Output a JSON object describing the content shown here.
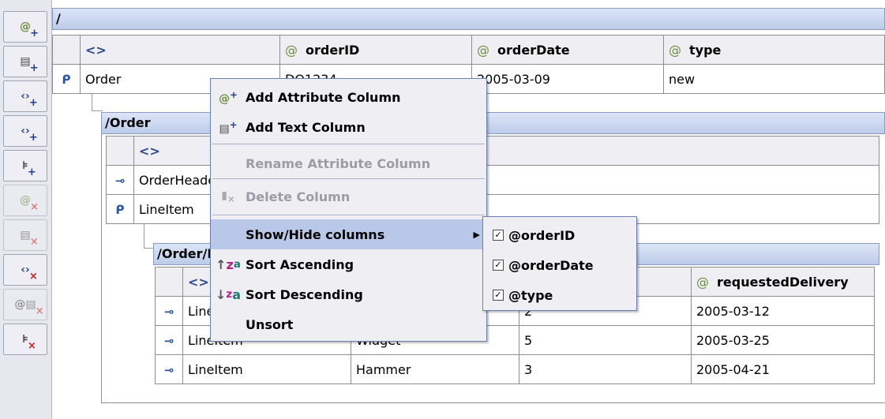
{
  "toolbar": {
    "buttons": [
      {
        "icon": "add-attribute-icon",
        "glyph": "@",
        "badge": "+",
        "enabled": true
      },
      {
        "icon": "add-text-icon",
        "glyph": "▤",
        "badge": "+",
        "enabled": true
      },
      {
        "icon": "add-element-icon",
        "glyph": "‹›",
        "badge": "+",
        "enabled": true
      },
      {
        "icon": "add-child-element-icon",
        "glyph": "‹›",
        "badge": "+",
        "enabled": true
      },
      {
        "icon": "add-tree-icon",
        "glyph": "⊧",
        "badge": "+",
        "enabled": true
      },
      {
        "icon": "delete-attribute-icon",
        "glyph": "@",
        "badge": "×",
        "enabled": false
      },
      {
        "icon": "delete-text-icon",
        "glyph": "▤",
        "badge": "×",
        "enabled": false
      },
      {
        "icon": "delete-element-icon",
        "glyph": "‹›",
        "badge": "×",
        "enabled": true
      },
      {
        "icon": "delete-mixed-icon",
        "glyph": "@▤",
        "badge": "×",
        "enabled": false
      },
      {
        "icon": "delete-tree-icon",
        "glyph": "⊧",
        "badge": "×",
        "enabled": true
      }
    ]
  },
  "root": {
    "path": "/",
    "headers": {
      "element": "<>",
      "col1": "orderID",
      "col2": "orderDate",
      "col3": "type"
    },
    "row": {
      "element": "Order",
      "orderID": "DO1234",
      "orderDate": "2005-03-09",
      "type": "new"
    }
  },
  "order": {
    "path": "/Order",
    "header_element": "<>",
    "rows": [
      "OrderHeader",
      "LineItem"
    ]
  },
  "lineitems": {
    "path": "/Order/LineItem",
    "header_element": "<>",
    "header_last": "requestedDelivery",
    "rows": [
      {
        "element": "LineItem",
        "product": "",
        "qty": "2",
        "date": "2005-03-12"
      },
      {
        "element": "LineItem",
        "product": "Widget",
        "qty": "5",
        "date": "2005-03-25"
      },
      {
        "element": "LineItem",
        "product": "Hammer",
        "qty": "3",
        "date": "2005-04-21"
      }
    ]
  },
  "context_menu": {
    "items": [
      {
        "label": "Add Attribute Column",
        "mnemonic": "A",
        "icon": "add-attribute-column-icon",
        "enabled": true
      },
      {
        "label": "Add Text Column",
        "mnemonic": "A",
        "icon": "add-text-column-icon",
        "enabled": true
      },
      {
        "label": "Rename Attribute Column",
        "mnemonic": "e",
        "icon": "",
        "enabled": false
      },
      {
        "label": "Delete Column",
        "mnemonic": "t",
        "icon": "delete-column-icon",
        "enabled": false
      },
      {
        "label": "Show/Hide columns",
        "icon": "",
        "enabled": true,
        "submenu": true
      },
      {
        "label": "Sort Ascending",
        "mnemonic": "S",
        "icon": "sort-ascending-icon",
        "enabled": true
      },
      {
        "label": "Sort Descending",
        "mnemonic": "S",
        "icon": "sort-descending-icon",
        "enabled": true
      },
      {
        "label": "Unsort",
        "mnemonic": "s",
        "icon": "",
        "enabled": true
      }
    ]
  },
  "submenu": {
    "items": [
      {
        "label": "@orderID",
        "checked": true
      },
      {
        "label": "@orderDate",
        "checked": true
      },
      {
        "label": "@type",
        "checked": true
      }
    ]
  },
  "colors": {
    "menu_bg": "#eeeef3",
    "menu_highlight": "#b9c7e8",
    "header_bar": "#bccbe8",
    "add_badge": "#1a3f8f",
    "delete_badge": "#d11a1a"
  }
}
